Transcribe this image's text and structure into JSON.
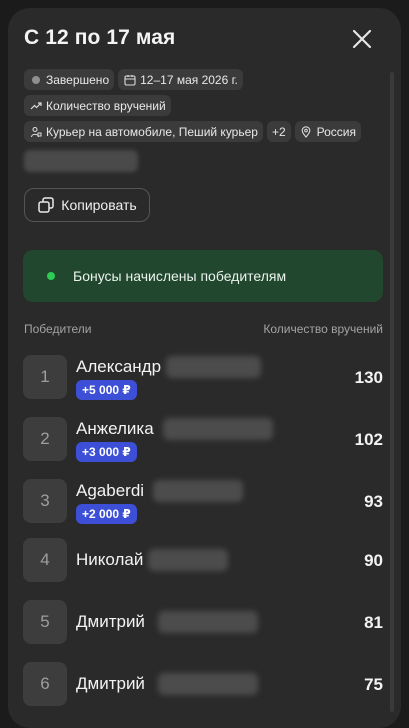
{
  "header": {
    "title": "С 12 по 17 мая"
  },
  "chips": {
    "status": "Завершено",
    "dates": "12–17 мая 2026 г.",
    "metric": "Количество вручений",
    "couriers": "Курьер на автомобиле, Пеший курьер",
    "more": "+2",
    "region": "Россия"
  },
  "actions": {
    "copy_label": "Копировать"
  },
  "bonus_banner": {
    "text": "Бонусы начислены победителям"
  },
  "table": {
    "col_winners": "Победители",
    "col_count": "Количество вручений",
    "rows": [
      {
        "rank": "1",
        "name": "Александр",
        "bonus": "+5 000 ₽",
        "count": "130"
      },
      {
        "rank": "2",
        "name": "Анжелика",
        "bonus": "+3 000 ₽",
        "count": "102"
      },
      {
        "rank": "3",
        "name": "Agaberdi",
        "bonus": "+2 000 ₽",
        "count": "93"
      },
      {
        "rank": "4",
        "name": "Николай",
        "bonus": "",
        "count": "90"
      },
      {
        "rank": "5",
        "name": "Дмитрий",
        "bonus": "",
        "count": "81"
      },
      {
        "rank": "6",
        "name": "Дмитрий",
        "bonus": "",
        "count": "75"
      }
    ]
  },
  "colors": {
    "panel": "#2a2a2a",
    "bonus_bg": "#22472f",
    "bonus_dot": "#2fcc55",
    "badge": "#3c4fd6"
  }
}
